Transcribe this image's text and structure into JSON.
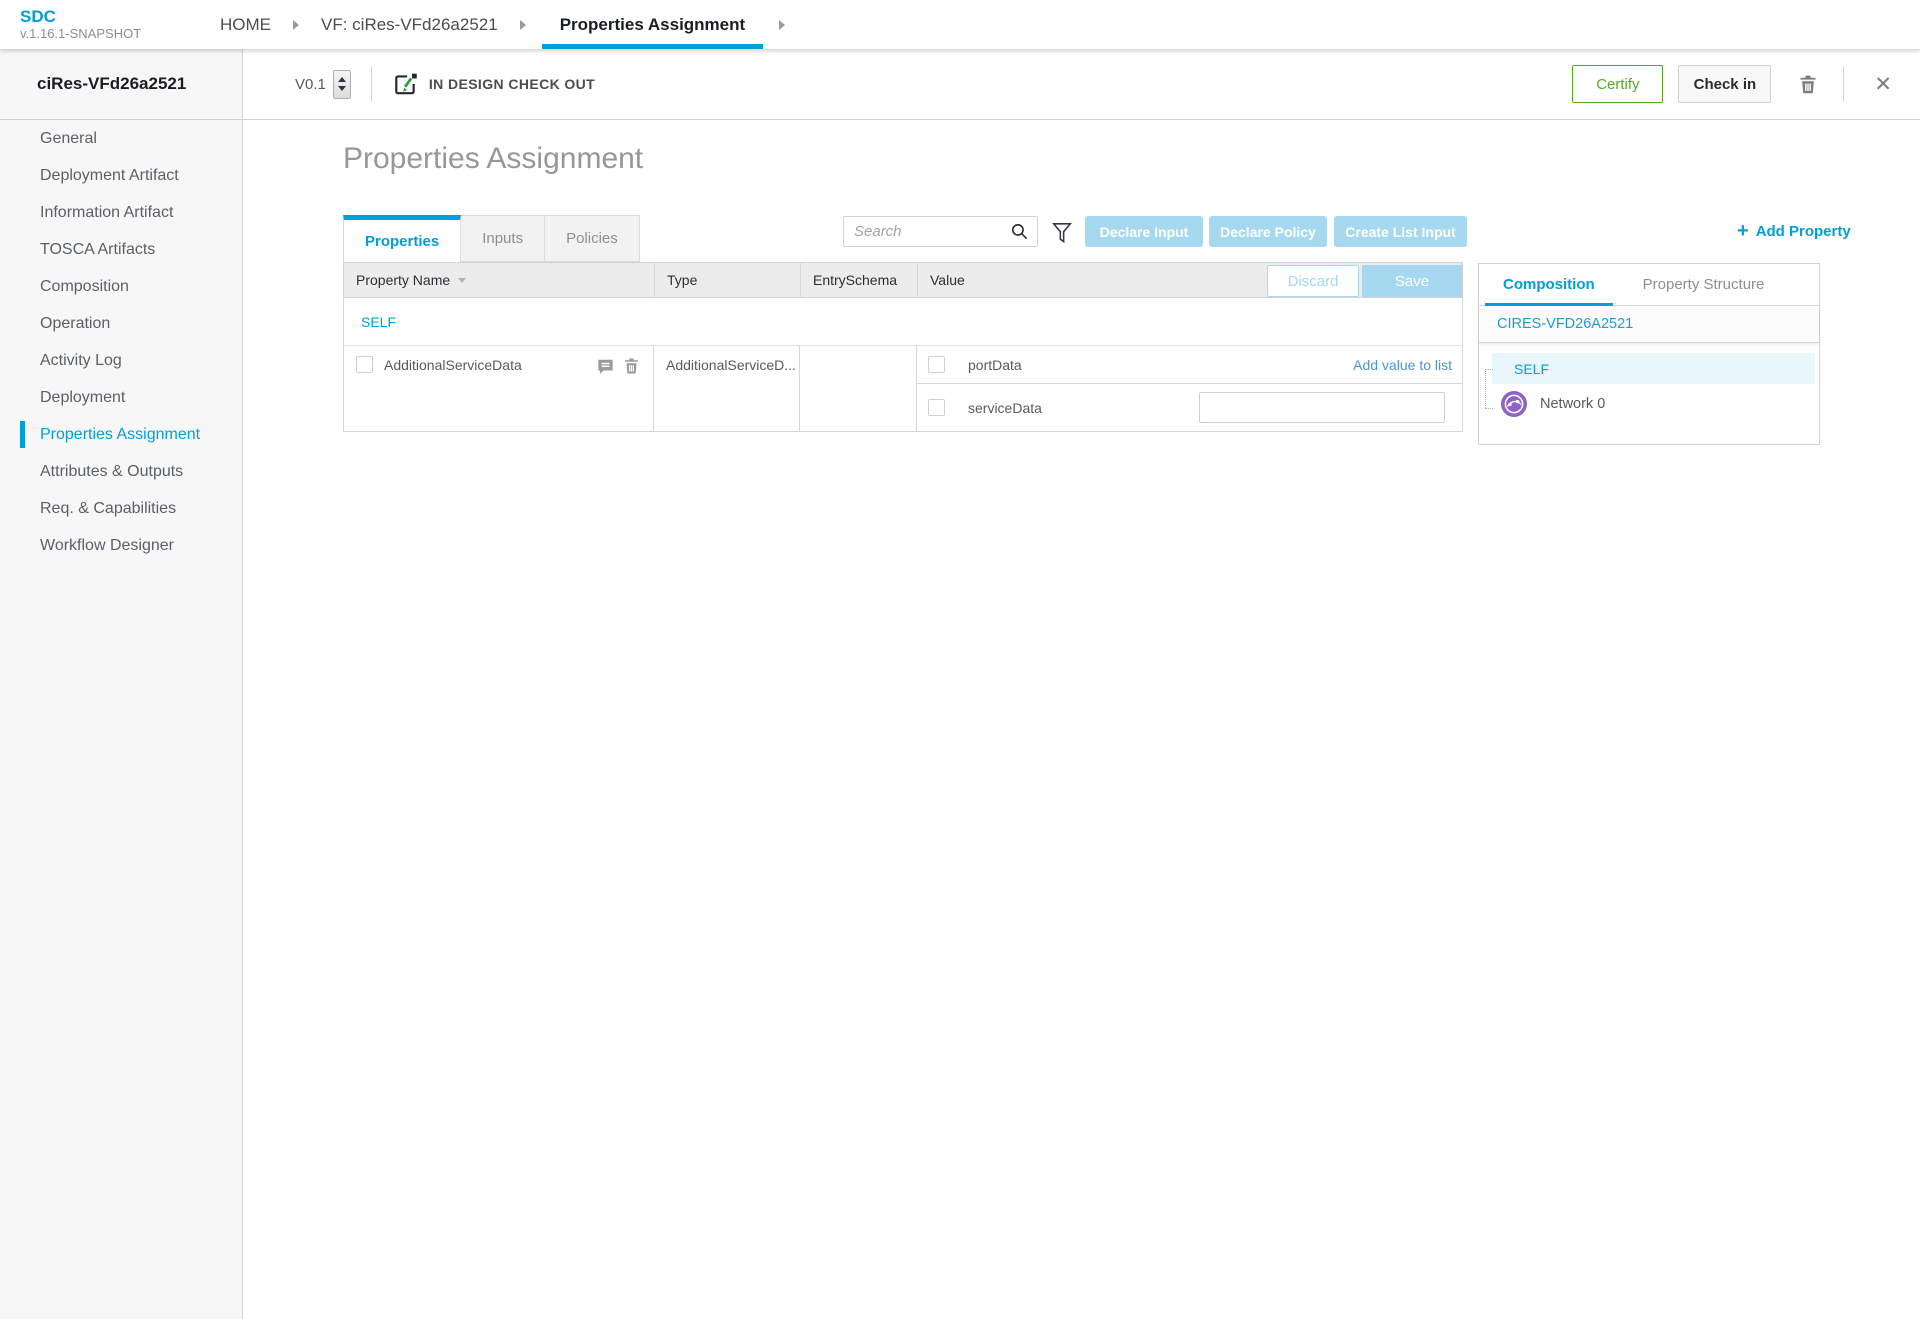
{
  "topnav": {
    "logo": "SDC",
    "version": "v.1.16.1-SNAPSHOT",
    "tabs": [
      {
        "label": "HOME"
      },
      {
        "label": "VF: ciRes-VFd26a2521"
      },
      {
        "label": "Properties Assignment"
      }
    ]
  },
  "sidebar": {
    "title": "ciRes-VFd26a2521",
    "items": [
      {
        "label": "General"
      },
      {
        "label": "Deployment Artifact"
      },
      {
        "label": "Information Artifact"
      },
      {
        "label": "TOSCA Artifacts"
      },
      {
        "label": "Composition"
      },
      {
        "label": "Operation"
      },
      {
        "label": "Activity Log"
      },
      {
        "label": "Deployment"
      },
      {
        "label": "Properties Assignment"
      },
      {
        "label": "Attributes & Outputs"
      },
      {
        "label": "Req. & Capabilities"
      },
      {
        "label": "Workflow Designer"
      }
    ]
  },
  "toolbar": {
    "version": "V0.1",
    "lifecycle_state": "IN DESIGN CHECK OUT",
    "certify_label": "Certify",
    "checkin_label": "Check in"
  },
  "main": {
    "title": "Properties Assignment",
    "tabs": [
      {
        "label": "Properties"
      },
      {
        "label": "Inputs"
      },
      {
        "label": "Policies"
      }
    ],
    "search_placeholder": "Search",
    "buttons": {
      "declare_input": "Declare Input",
      "declare_policy": "Declare Policy",
      "create_list_input": "Create List Input"
    },
    "add_property_label": "Add Property",
    "table": {
      "headers": [
        "Property Name",
        "Type",
        "EntrySchema",
        "Value"
      ],
      "discard_label": "Discard",
      "save_label": "Save",
      "group_label": "SELF",
      "rows": [
        {
          "name": "AdditionalServiceData",
          "type": "AdditionalServiceD...",
          "entry_schema": "",
          "values": [
            {
              "label": "portData",
              "action": "Add value to list"
            },
            {
              "label": "serviceData",
              "input_value": ""
            }
          ]
        }
      ]
    }
  },
  "right_panel": {
    "tabs": [
      {
        "label": "Composition"
      },
      {
        "label": "Property Structure"
      }
    ],
    "component_name": "CIRES-VFD26A2521",
    "tree": {
      "self_label": "SELF",
      "nodes": [
        {
          "label": "Network 0"
        }
      ]
    }
  },
  "icons": {
    "plus": "+",
    "close": "✕"
  },
  "colors": {
    "accent_blue": "#009fdb",
    "light_blue_button": "#a6d8ef",
    "certify_green": "#55ab1f",
    "network_node_purple": "#9162c5"
  }
}
